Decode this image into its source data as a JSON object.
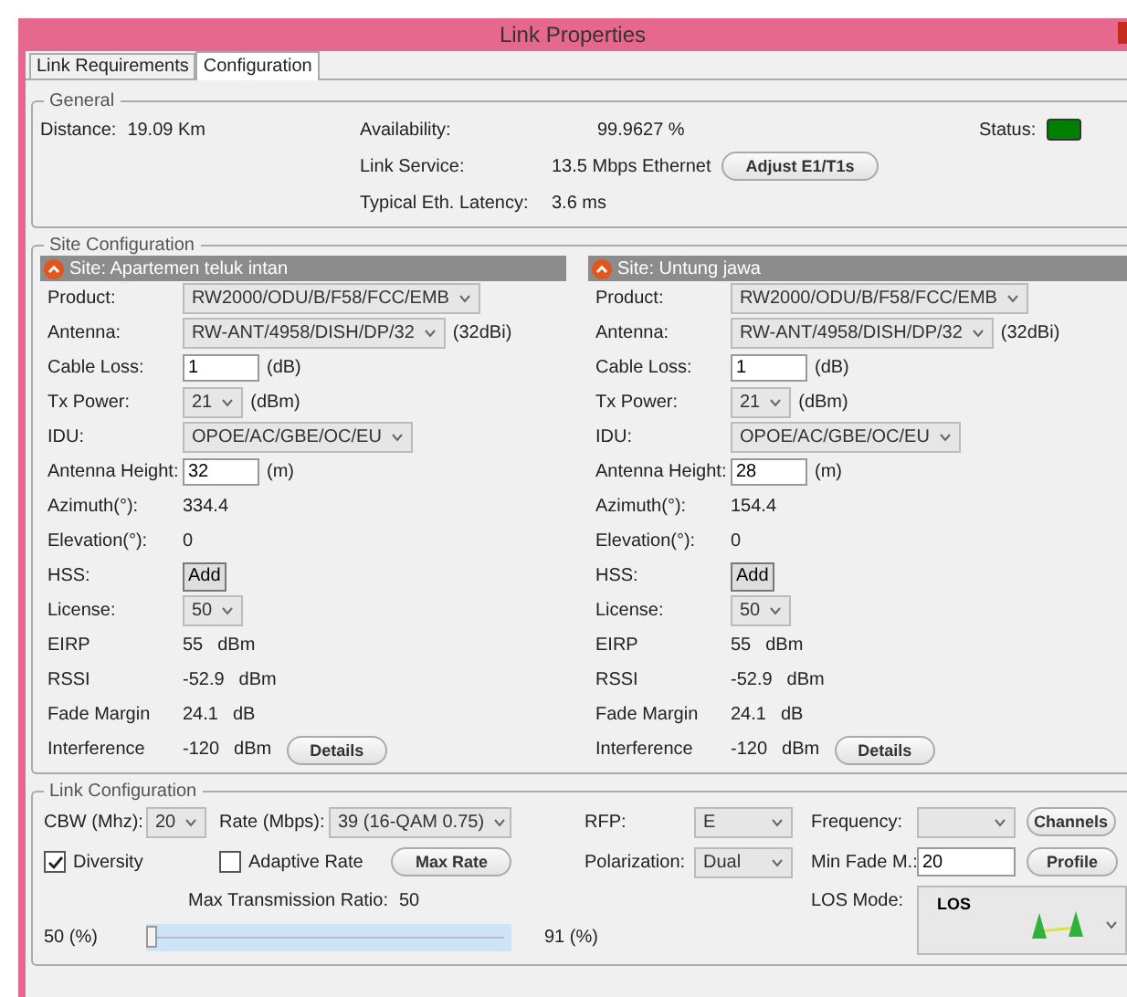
{
  "window": {
    "title": "Link Properties"
  },
  "tabs": [
    {
      "label": "Link Requirements",
      "selected": false
    },
    {
      "label": "Configuration",
      "selected": true
    }
  ],
  "general": {
    "title": "General",
    "distance": {
      "label": "Distance:",
      "value": "19.09 Km"
    },
    "availability": {
      "label": "Availability:",
      "value": "99.9627 %"
    },
    "link_service": {
      "label": "Link Service:",
      "value": "13.5 Mbps Ethernet",
      "button": "Adjust E1/T1s"
    },
    "latency": {
      "label": "Typical Eth. Latency:",
      "value": "3.6 ms"
    },
    "status": {
      "label": "Status:",
      "color": "#008000"
    }
  },
  "site_configuration": {
    "title": "Site Configuration",
    "sites": [
      {
        "header": "Site: Apartemen teluk intan",
        "rows": [
          {
            "kind": "select",
            "label": "Product:",
            "value": "RW2000/ODU/B/F58/FCC/EMB"
          },
          {
            "kind": "select",
            "label": "Antenna:",
            "value": "RW-ANT/4958/DISH/DP/32",
            "unit": "(32dBi)"
          },
          {
            "kind": "input",
            "label": "Cable Loss:",
            "value": "1",
            "unit": "(dB)"
          },
          {
            "kind": "select",
            "label": "Tx Power:",
            "value": "21",
            "unit": "(dBm)"
          },
          {
            "kind": "select",
            "label": "IDU:",
            "value": "OPOE/AC/GBE/OC/EU"
          },
          {
            "kind": "input",
            "label": "Antenna Height:",
            "value": "32",
            "unit": "(m)"
          },
          {
            "kind": "text",
            "label": "Azimuth(°):",
            "value": "334.4"
          },
          {
            "kind": "text",
            "label": "Elevation(°):",
            "value": "0"
          },
          {
            "kind": "button",
            "label": "HSS:",
            "value": "Add"
          },
          {
            "kind": "select",
            "label": "License:",
            "value": "50"
          },
          {
            "kind": "text",
            "label": "EIRP",
            "value": "55",
            "unit": "dBm"
          },
          {
            "kind": "text",
            "label": "RSSI",
            "value": "-52.9",
            "unit": "dBm"
          },
          {
            "kind": "text",
            "label": "Fade Margin",
            "value": "24.1",
            "unit": "dB"
          },
          {
            "kind": "text",
            "label": "Interference",
            "value": "-120",
            "unit": "dBm",
            "button": "Details"
          }
        ]
      },
      {
        "header": "Site: Untung jawa",
        "rows": [
          {
            "kind": "select",
            "label": "Product:",
            "value": "RW2000/ODU/B/F58/FCC/EMB"
          },
          {
            "kind": "select",
            "label": "Antenna:",
            "value": "RW-ANT/4958/DISH/DP/32",
            "unit": "(32dBi)"
          },
          {
            "kind": "input",
            "label": "Cable Loss:",
            "value": "1",
            "unit": "(dB)"
          },
          {
            "kind": "select",
            "label": "Tx Power:",
            "value": "21",
            "unit": "(dBm)"
          },
          {
            "kind": "select",
            "label": "IDU:",
            "value": "OPOE/AC/GBE/OC/EU"
          },
          {
            "kind": "input",
            "label": "Antenna Height:",
            "value": "28",
            "unit": "(m)"
          },
          {
            "kind": "text",
            "label": "Azimuth(°):",
            "value": "154.4"
          },
          {
            "kind": "text",
            "label": "Elevation(°):",
            "value": "0"
          },
          {
            "kind": "button",
            "label": "HSS:",
            "value": "Add"
          },
          {
            "kind": "select",
            "label": "License:",
            "value": "50"
          },
          {
            "kind": "text",
            "label": "EIRP",
            "value": "55",
            "unit": "dBm"
          },
          {
            "kind": "text",
            "label": "RSSI",
            "value": "-52.9",
            "unit": "dBm"
          },
          {
            "kind": "text",
            "label": "Fade Margin",
            "value": "24.1",
            "unit": "dB"
          },
          {
            "kind": "text",
            "label": "Interference",
            "value": "-120",
            "unit": "dBm",
            "button": "Details"
          }
        ]
      }
    ]
  },
  "link_configuration": {
    "title": "Link Configuration",
    "cbw": {
      "label": "CBW (Mhz):",
      "value": "20"
    },
    "rate": {
      "label": "Rate (Mbps):",
      "value": "39 (16-QAM 0.75)"
    },
    "rfp": {
      "label": "RFP:",
      "value": "E"
    },
    "frequency": {
      "label": "Frequency:"
    },
    "channels_button": "Channels",
    "diversity": {
      "label": "Diversity",
      "checked": true
    },
    "adaptive_rate": {
      "label": "Adaptive Rate",
      "checked": false
    },
    "max_rate_button": "Max Rate",
    "polarization": {
      "label": "Polarization:",
      "value": "Dual"
    },
    "min_fade": {
      "label": "Min Fade M.:",
      "value": "20"
    },
    "profile_button": "Profile",
    "max_ratio": {
      "label": "Max Transmission Ratio:",
      "value": "50"
    },
    "los_mode": {
      "label": "LOS Mode:",
      "value": "LOS"
    },
    "ratio_slider": {
      "min_label": "50 (%)",
      "max_label": "91 (%)",
      "level": 0
    }
  }
}
